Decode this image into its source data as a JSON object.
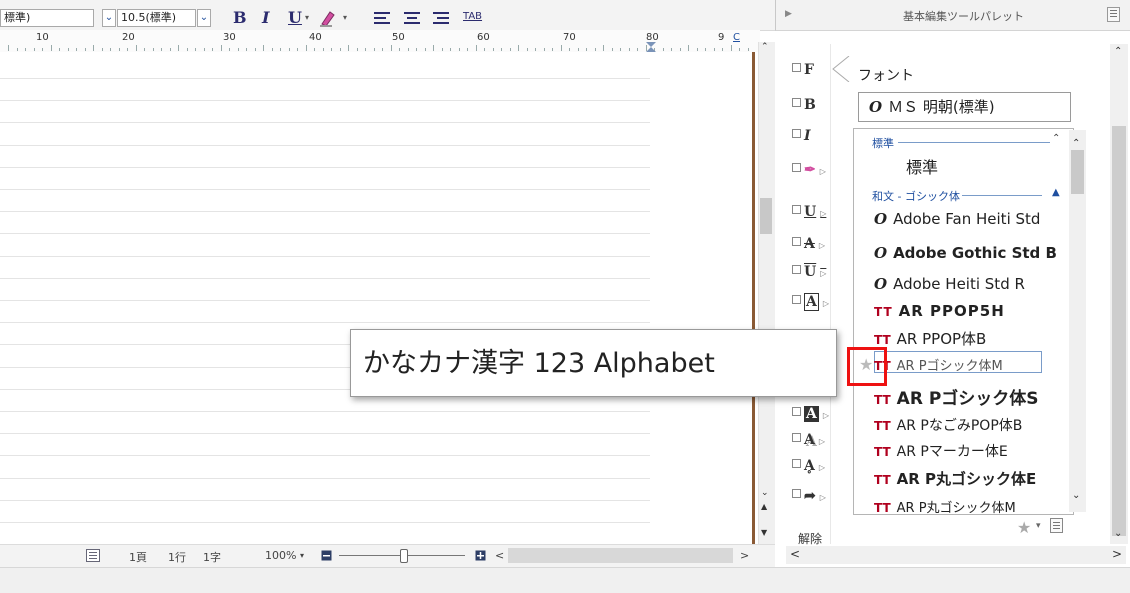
{
  "toolbar": {
    "style_value": "標準)",
    "size_value": "10.5(標準)",
    "bold_label": "B",
    "italic_label": "I",
    "underline_label": "U",
    "tab_label": "TAB"
  },
  "ruler": {
    "numbers": [
      "10",
      "20",
      "30",
      "40",
      "50",
      "60",
      "70",
      "80"
    ],
    "col_marker": "9",
    "c_marker": "C"
  },
  "status_bar": {
    "page": "1頁",
    "line": "1行",
    "char": "1字",
    "zoom": "100%"
  },
  "palette": {
    "title": "基本編集ツールパレット",
    "font_label": "フォント",
    "current_font": "ＭＳ 明朝(標準)",
    "release_label": "解除",
    "icon_letters": [
      "F",
      "B",
      "I"
    ],
    "categories": [
      "標準",
      "和文 - ゴシック体"
    ],
    "fonts": [
      {
        "name": "標準",
        "icon": ""
      },
      {
        "name": "Adobe Fan Heiti Std",
        "icon": "O"
      },
      {
        "name": "Adobe Gothic Std B",
        "icon": "O"
      },
      {
        "name": "Adobe Heiti Std R",
        "icon": "O"
      },
      {
        "name": "AR PPOP5H",
        "icon": "TT"
      },
      {
        "name": "AR PPOP体B",
        "icon": "TT"
      },
      {
        "name": "AR Pゴシック体M",
        "icon": "TT"
      },
      {
        "name": "AR Pゴシック体S",
        "icon": "TT"
      },
      {
        "name": "AR PなごみPOP体B",
        "icon": "TT"
      },
      {
        "name": "AR Pマーカー体E",
        "icon": "TT"
      },
      {
        "name": "AR P丸ゴシック体E",
        "icon": "TT"
      },
      {
        "name": "AR P丸ゴシック体M",
        "icon": "TT"
      }
    ],
    "colors": {
      "accent": "#1f4fa0",
      "tt_icon": "#b0001e",
      "highlight": "#e11111"
    }
  },
  "preview": {
    "text": "かなカナ漢字 123 Alphabet"
  }
}
